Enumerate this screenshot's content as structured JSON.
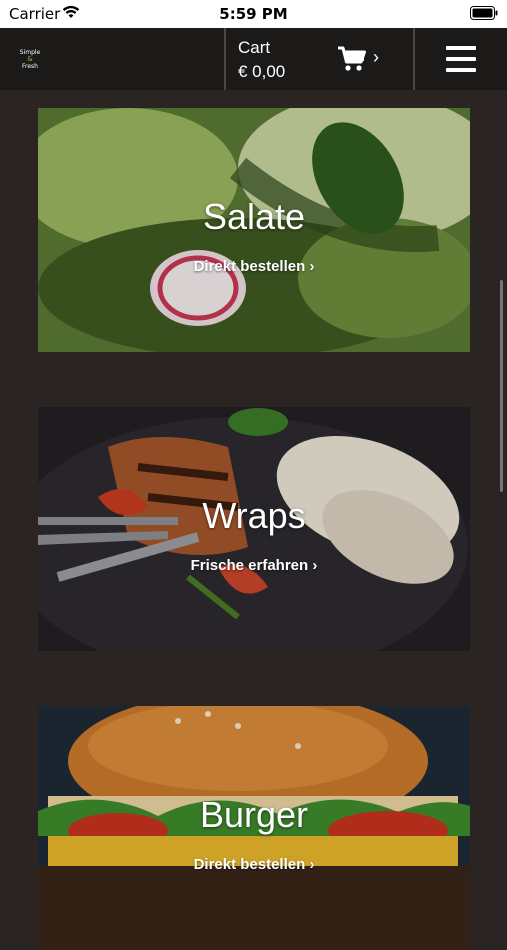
{
  "status_bar": {
    "carrier": "Carrier",
    "time": "5:59 PM"
  },
  "header": {
    "logo": {
      "line1": "Simple",
      "line2": "&",
      "line3": "Fresh"
    },
    "cart": {
      "label": "Cart",
      "amount": "€ 0,00",
      "chevron": "›"
    },
    "icons": [
      "cart-icon",
      "hamburger-menu-icon"
    ]
  },
  "categories": [
    {
      "title": "Salate",
      "cta": "Direkt bestellen ›"
    },
    {
      "title": "Wraps",
      "cta": "Frische erfahren ›"
    },
    {
      "title": "Burger",
      "cta": "Direkt bestellen ›"
    }
  ],
  "colors": {
    "background": "#2a2523",
    "header": "#1c1a19",
    "text": "#ffffff",
    "accent": "#7fbf3f"
  }
}
